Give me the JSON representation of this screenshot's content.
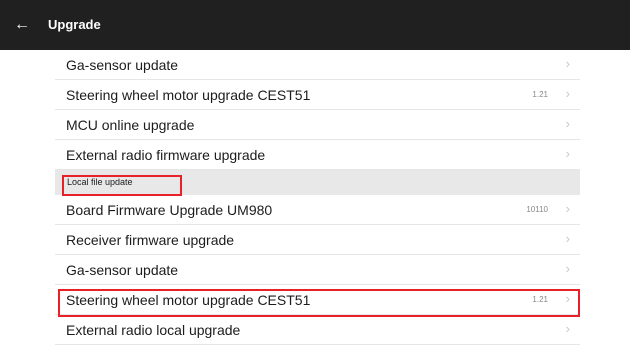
{
  "header": {
    "back_icon": "arrow-left-icon",
    "title": "Upgrade"
  },
  "items_top": [
    {
      "label": "Ga-sensor update",
      "value": ""
    },
    {
      "label": "Steering wheel motor upgrade CEST51",
      "value": "1.21"
    },
    {
      "label": "MCU online upgrade",
      "value": ""
    },
    {
      "label": "External radio firmware upgrade",
      "value": ""
    }
  ],
  "section": {
    "label": "Local file update"
  },
  "items_bottom": [
    {
      "label": "Board Firmware Upgrade  UM980",
      "value": "10110"
    },
    {
      "label": "Receiver firmware upgrade",
      "value": ""
    },
    {
      "label": "Ga-sensor update",
      "value": ""
    },
    {
      "label": "Steering wheel motor upgrade CEST51",
      "value": "1.21"
    },
    {
      "label": "External radio local upgrade",
      "value": ""
    }
  ],
  "chevron_icon": "chevron-right-icon",
  "colors": {
    "header_bg": "#202020",
    "section_bg": "#e8e8e8",
    "highlight": "#e8202a"
  }
}
